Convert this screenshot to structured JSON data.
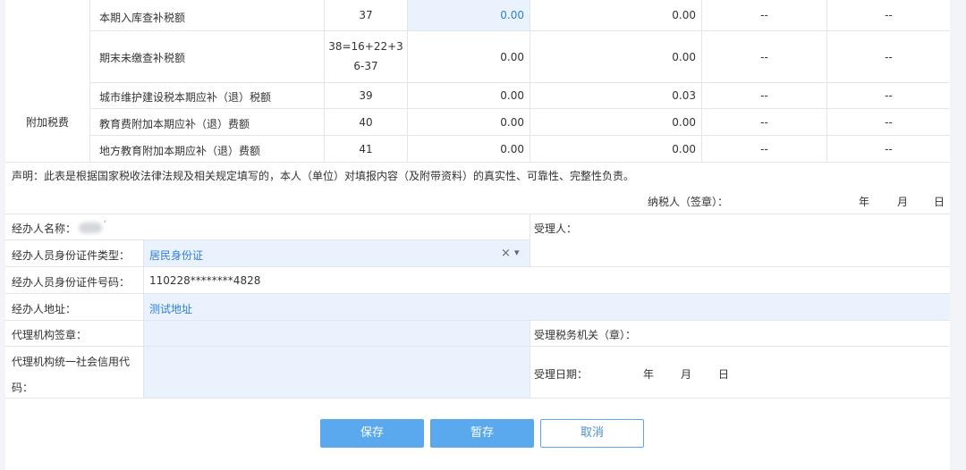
{
  "table": {
    "rows": [
      {
        "label": "本期入库查补税额",
        "line": "37",
        "v1": "0.00",
        "v2": "0.00",
        "v3": "--",
        "v4": "--"
      },
      {
        "label": "期末未缴查补税额",
        "line_a": "38=16+22+3",
        "line_b": "6-37",
        "v1": "0.00",
        "v2": "0.00",
        "v3": "--",
        "v4": "--"
      },
      {
        "label": "城市维护建设税本期应补（退）税额",
        "line": "39",
        "v1": "0.00",
        "v2": "0.03",
        "v3": "--",
        "v4": "--"
      },
      {
        "label": "教育费附加本期应补（退）费额",
        "line": "40",
        "v1": "0.00",
        "v2": "0.00",
        "v3": "--",
        "v4": "--"
      },
      {
        "label": "地方教育附加本期应补（退）费额",
        "line": "41",
        "v1": "0.00",
        "v2": "0.00",
        "v3": "--",
        "v4": "--"
      }
    ],
    "group_label": "附加税费"
  },
  "declaration": {
    "text": "声明：此表是根据国家税收法律法规及相关规定填写的，本人（单位）对填报内容（及附带资料）的真实性、可靠性、完整性负责。",
    "signer": "纳税人（签章）：",
    "year": "年",
    "month": "月",
    "day": "日"
  },
  "form": {
    "agent_name_label": "经办人名称：",
    "agent_name_value_tail": "′",
    "receiver_label": "受理人：",
    "id_type_label": "经办人员身份证件类型：",
    "id_type_value": "居民身份证",
    "clear_glyph": "×",
    "dropdown_glyph": "▾",
    "id_number_label": "经办人员身份证件号码：",
    "id_number_value": "110228********4828",
    "address_label": "经办人地址：",
    "address_value": "测试地址",
    "agency_seal_label": "代理机构签章：",
    "tax_office_label": "受理税务机关（章）：",
    "agency_code_label_a": "代理机构统一社会信用代",
    "agency_code_label_b": "码：",
    "accept_date_label": "受理日期：",
    "accept_year": "年",
    "accept_month": "月",
    "accept_day": "日"
  },
  "buttons": {
    "save": "保存",
    "draft": "暂存",
    "cancel": "取消"
  }
}
